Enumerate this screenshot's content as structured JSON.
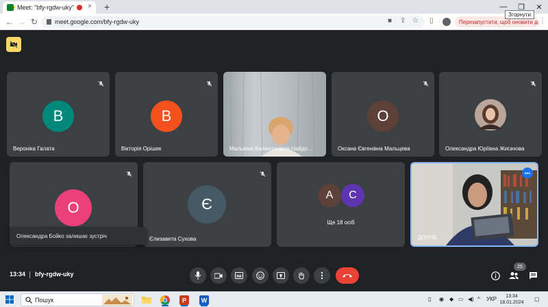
{
  "browser": {
    "tab_title": "Meet: \"bfy-rgdw-uky\"",
    "tab_close": "×",
    "new_tab": "+",
    "url": "meet.google.com/bfy-rgdw-uky",
    "update_button": "Перезапустити, щоб оновити дані",
    "tooltip": "Згорнути",
    "window_controls": [
      "—",
      "❐",
      "✕"
    ]
  },
  "participants": [
    {
      "name": "Вероніка Галата",
      "initial": "В",
      "avatar_color": "#00897b",
      "muted": true
    },
    {
      "name": "Вікторія Орішек",
      "initial": "В",
      "avatar_color": "#f4511e",
      "muted": true
    },
    {
      "name": "Мальвіна Валентинівна Найдо...",
      "video": true,
      "muted": false
    },
    {
      "name": "Оксана Євгенівна Мальцева",
      "initial": "О",
      "avatar_color": "#5d4037",
      "muted": true
    },
    {
      "name": "Олександра Юріївна Жигачова",
      "photo": true,
      "muted": true
    },
    {
      "name": "",
      "initial": "О",
      "avatar_color": "#ec407a",
      "muted": true
    },
    {
      "name": "Єлизавета Сухова",
      "initial": "Є",
      "avatar_color": "#455a64",
      "muted": true
    },
    {
      "name": "Ще 18 осіб",
      "group": true,
      "initials": [
        "А",
        "С"
      ],
      "avatar_colors": [
        "#5d4037",
        "#5e35b1"
      ]
    },
    {
      "name": "ДОУНБ",
      "video": true,
      "pinned": true,
      "menu_icon": "•••"
    }
  ],
  "notice": "Олександра Бойко залишає зустріч",
  "bottom": {
    "time": "13:34",
    "meeting_code": "bfy-rgdw-uky",
    "participant_count": "25"
  },
  "taskbar": {
    "search_placeholder": "Пошук",
    "language": "УКР",
    "time": "13:34",
    "date": "18.01.2024"
  },
  "colors": {
    "background": "#202124",
    "tile": "#3c4043",
    "end_call": "#ea4335",
    "active_border": "#8ab4f8",
    "hide_button": "#fdd663"
  }
}
